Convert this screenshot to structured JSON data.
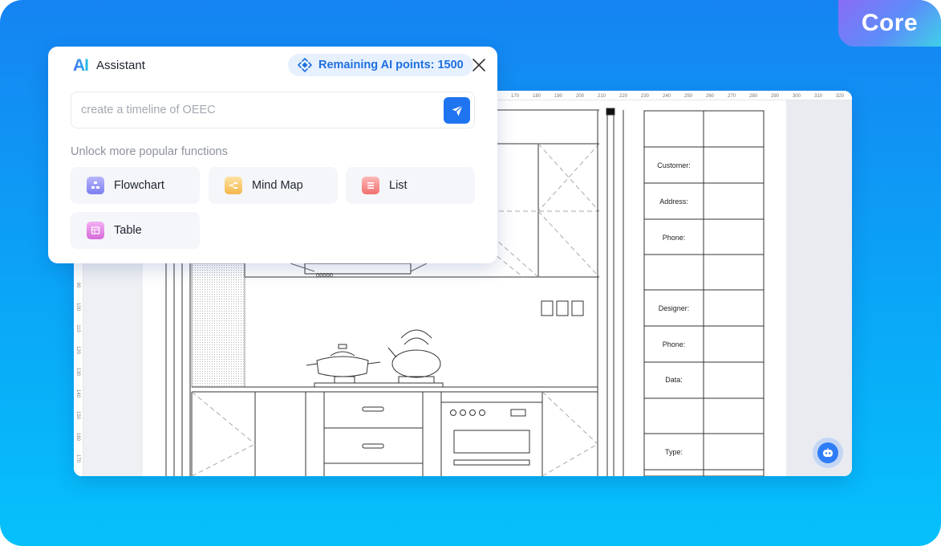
{
  "badge": {
    "label": "Core"
  },
  "assistant": {
    "logo": "AI",
    "title": "Assistant",
    "points_label": "Remaining AI points: 1500",
    "prompt_value": "create a timeline of OEEC",
    "unlock_label": "Unlock more popular functions",
    "functions": [
      {
        "label": "Flowchart",
        "icon": "flowchart-icon",
        "color": "#7b7ff2"
      },
      {
        "label": "Mind Map",
        "icon": "mind-map-icon",
        "color": "#f5b64a"
      },
      {
        "label": "List",
        "icon": "list-icon",
        "color": "#f26f6f"
      },
      {
        "label": "Table",
        "icon": "table-icon",
        "color": "#d66ad8"
      }
    ]
  },
  "ruler": {
    "top_ticks": [
      "170",
      "180",
      "190",
      "200",
      "210",
      "220",
      "230",
      "240",
      "250",
      "260",
      "270",
      "280",
      "290",
      "300",
      "310",
      "320"
    ],
    "left_ticks": [
      "90",
      "100",
      "110",
      "120",
      "130",
      "140",
      "150",
      "160",
      "170"
    ]
  },
  "title_block": {
    "labels": [
      "Customer:",
      "Address:",
      "Phone:",
      "Designer:",
      "Phone:",
      "Data:",
      "Type:"
    ]
  },
  "drawing": {
    "oven_knob_text": "OOOOO"
  },
  "colors": {
    "accent": "#1f74f0",
    "background_top": "#1584f2",
    "background_bottom": "#06c1fb"
  }
}
